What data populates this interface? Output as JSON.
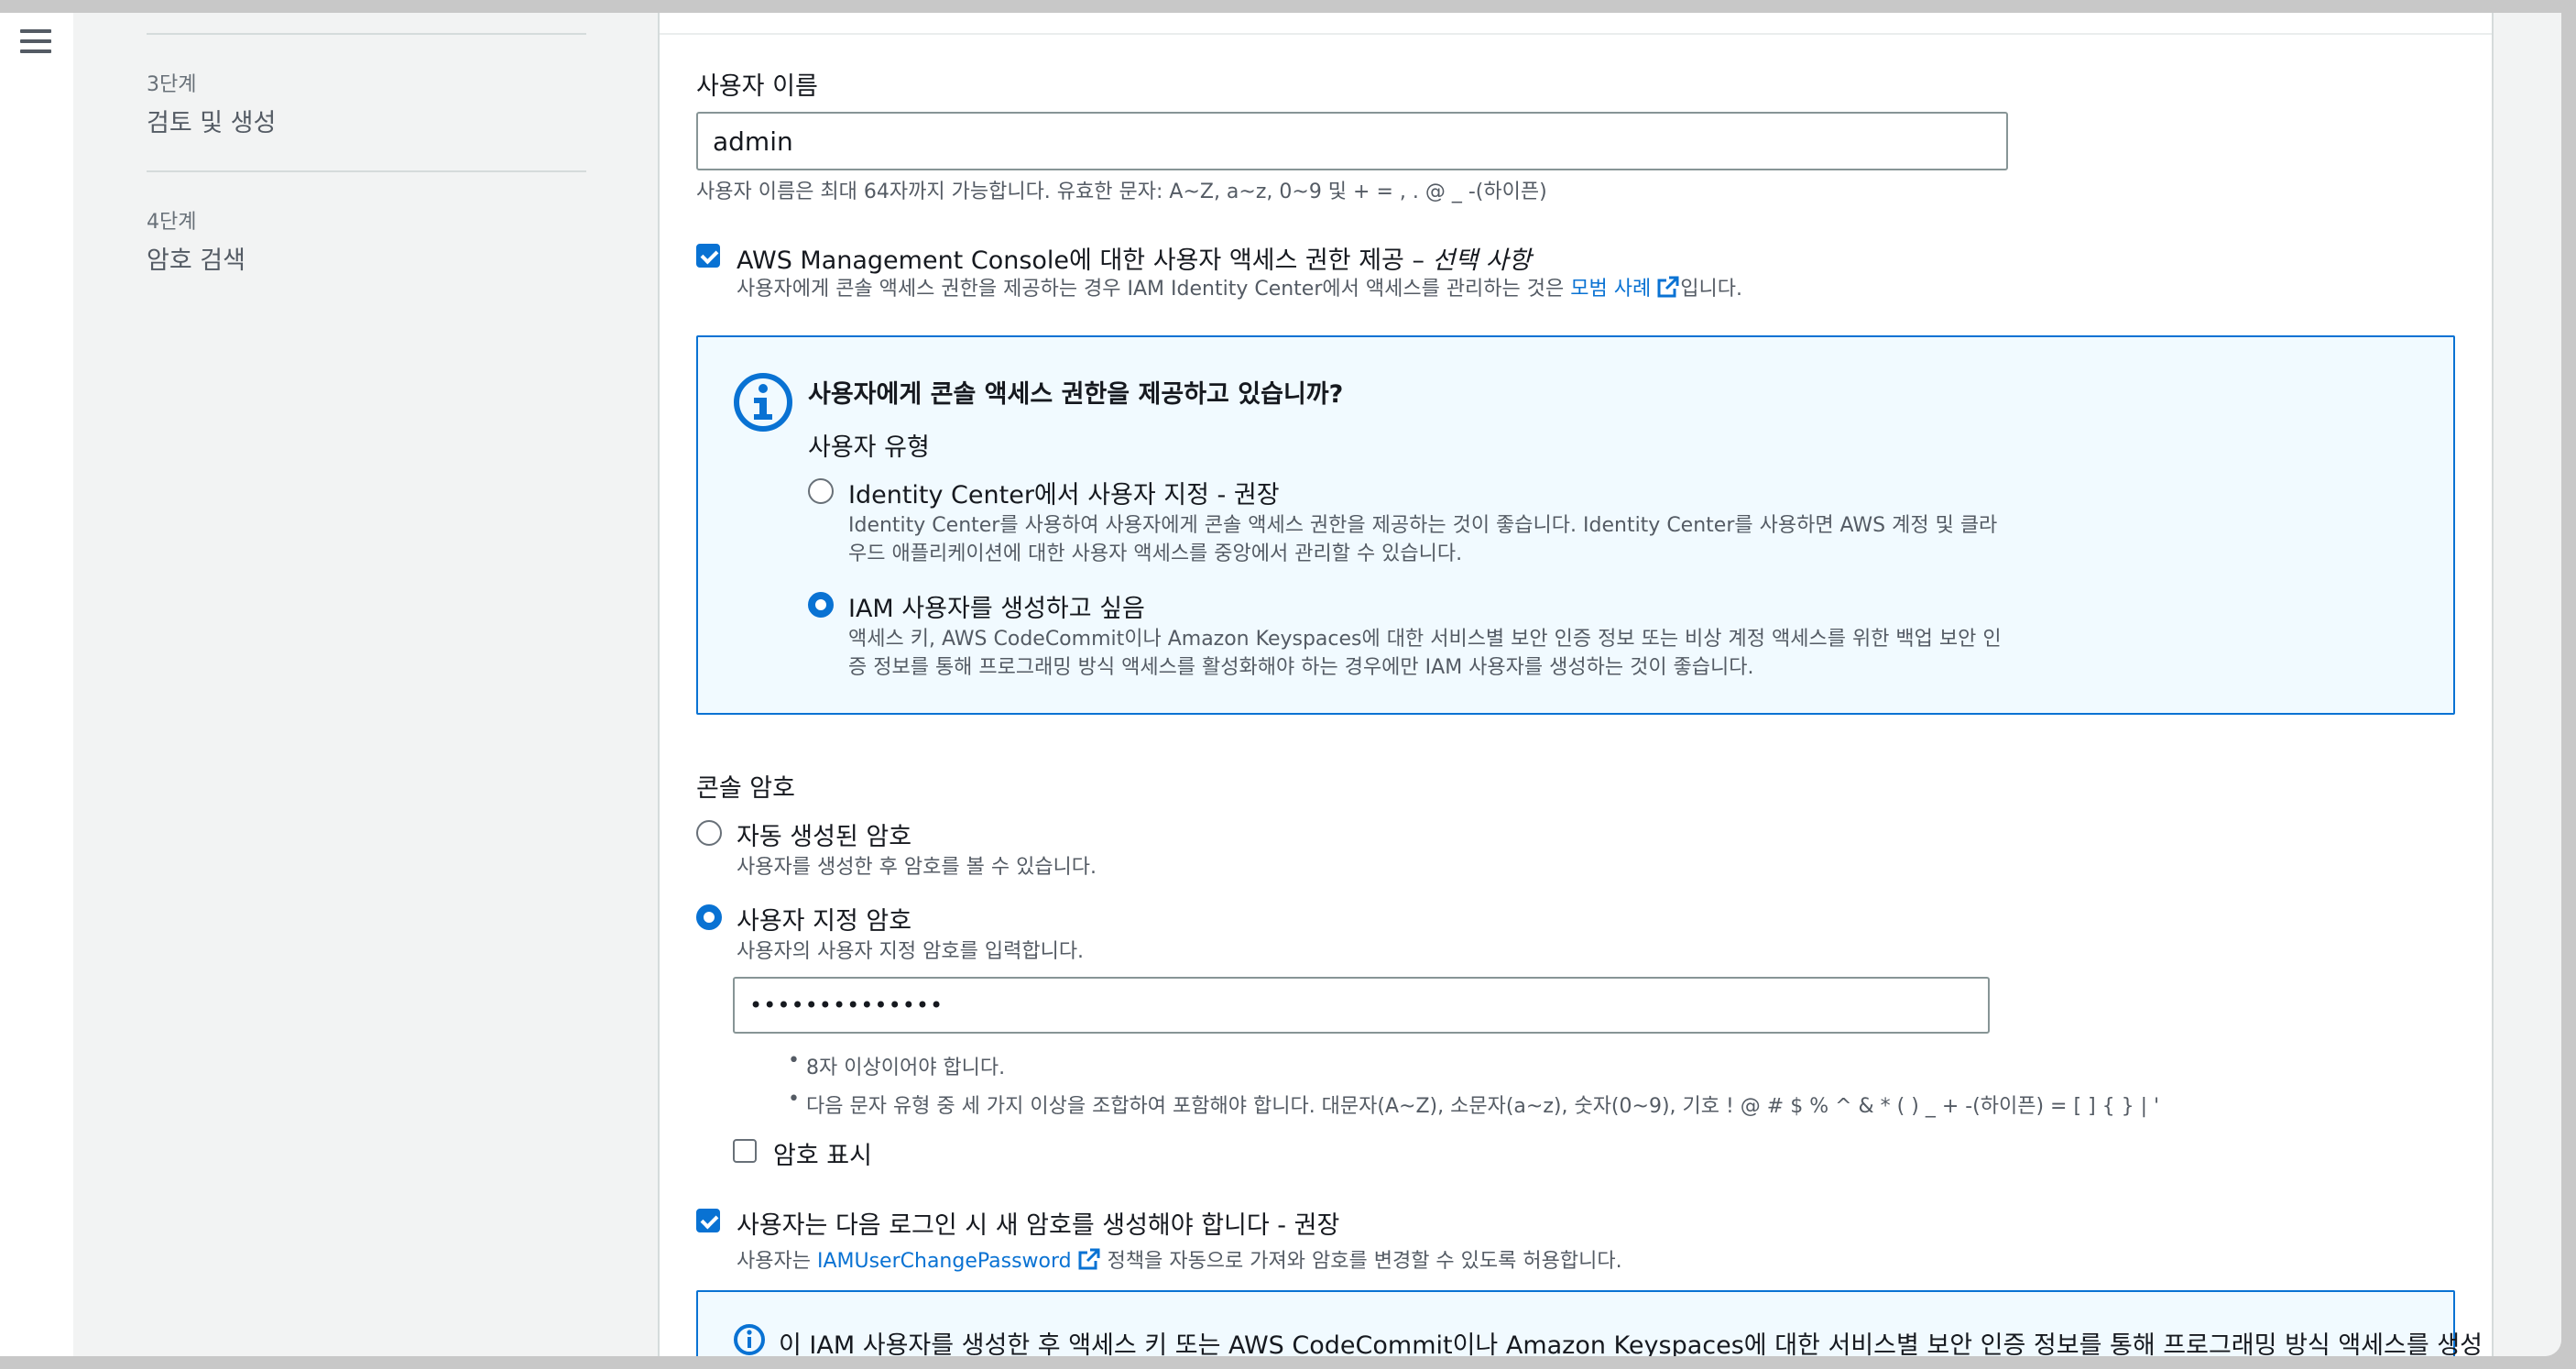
{
  "steps": [
    {
      "label": "3단계",
      "name": "검토 및 생성"
    },
    {
      "label": "4단계",
      "name": "암호 검색"
    }
  ],
  "user_name": {
    "label": "사용자 이름",
    "value": "admin",
    "hint": "사용자 이름은 최대 64자까지 가능합니다. 유효한 문자: A~Z, a~z, 0~9 및 + = , . @ _ -(하이픈)"
  },
  "console_access": {
    "label_main": "AWS Management Console에 대한 사용자 액세스 권한 제공 – ",
    "label_optional": "선택 사항",
    "checked": true,
    "desc_before": "사용자에게 콘솔 액세스 권한을 제공하는 경우 IAM Identity Center에서 액세스를 관리하는 것은 ",
    "desc_link": "모범 사례",
    "desc_after": "입니다."
  },
  "info_box": {
    "title": "사용자에게 콘솔 액세스 권한을 제공하고 있습니까?",
    "user_type_label": "사용자 유형",
    "options": [
      {
        "label": "Identity Center에서 사용자 지정 - 권장",
        "desc1": "Identity Center를 사용하여 사용자에게 콘솔 액세스 권한을 제공하는 것이 좋습니다. Identity Center를 사용하면 AWS 계정 및 클라",
        "desc2": "우드 애플리케이션에 대한 사용자 액세스를 중앙에서 관리할 수 있습니다.",
        "selected": false
      },
      {
        "label": "IAM 사용자를 생성하고 싶음",
        "desc1": "액세스 키, AWS CodeCommit이나 Amazon Keyspaces에 대한 서비스별 보안 인증 정보 또는 비상 계정 액세스를 위한 백업 보안 인",
        "desc2": "증 정보를 통해 프로그래밍 방식 액세스를 활성화해야 하는 경우에만 IAM 사용자를 생성하는 것이 좋습니다.",
        "selected": true
      }
    ]
  },
  "console_password": {
    "label": "콘솔 암호",
    "auto": {
      "label": "자동 생성된 암호",
      "desc": "사용자를 생성한 후 암호를 볼 수 있습니다.",
      "selected": false
    },
    "custom": {
      "label": "사용자 지정 암호",
      "desc": "사용자의 사용자 지정 암호를 입력합니다.",
      "selected": true
    },
    "masked_value": "••••••••••••••",
    "rules": [
      "8자 이상이어야 합니다.",
      "다음 문자 유형 중 세 가지 이상을 조합하여 포함해야 합니다. 대문자(A~Z), 소문자(a~z), 숫자(0~9), 기호 ! @ # $ % ^ & * ( ) _ + -(하이픈) = [ ] { } | '"
    ],
    "show_password_label": "암호 표시",
    "show_password_checked": false
  },
  "force_reset": {
    "label": "사용자는 다음 로그인 시 새 암호를 생성해야 합니다 - 권장",
    "checked": true,
    "desc_before": "사용자는 ",
    "desc_link": "IAMUserChangePassword",
    "desc_after": " 정책을 자동으로 가져와 암호를 변경할 수 있도록 허용합니다."
  },
  "bottom_info": {
    "text": "이 IAM 사용자를 생성한 후 액세스 키 또는 AWS CodeCommit이나 Amazon Keyspaces에 대한 서비스별 보안 인증 정보를 통해 프로그래밍 방식 액세스를 생성"
  },
  "colors": {
    "accent": "#0972d3",
    "info_bg": "#f1faff",
    "text": "#16191f",
    "muted": "#545b64"
  }
}
